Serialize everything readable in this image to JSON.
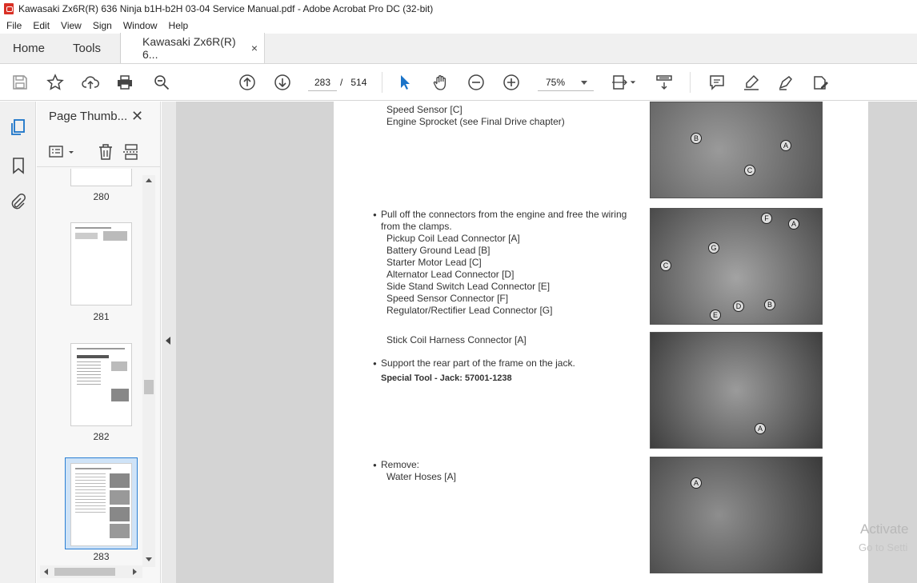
{
  "window": {
    "title": "Kawasaki Zx6R(R) 636 Ninja b1H-b2H 03-04 Service Manual.pdf - Adobe Acrobat Pro DC (32-bit)"
  },
  "menu": [
    "File",
    "Edit",
    "View",
    "Sign",
    "Window",
    "Help"
  ],
  "tabs": {
    "home": "Home",
    "tools": "Tools",
    "doc": "Kawasaki Zx6R(R) 6...",
    "close": "×"
  },
  "toolbar": {
    "current_page": "283",
    "separator": "/",
    "total_pages": "514",
    "zoom": "75%"
  },
  "panel": {
    "title": "Page Thumb...",
    "close": "✕",
    "thumbnails": [
      {
        "label": "280"
      },
      {
        "label": "281"
      },
      {
        "label": "282"
      },
      {
        "label": "283"
      }
    ]
  },
  "page": {
    "lines": {
      "l1": "Speed Sensor [C]",
      "l2": "Engine Sprocket (see Final Drive chapter)",
      "b1a": "Pull off the connectors from the engine and free the wiring",
      "b1b": "from the clamps.",
      "c1": "Pickup Coil Lead Connector [A]",
      "c2": "Battery Ground Lead [B]",
      "c3": "Starter Motor Lead [C]",
      "c4": "Alternator Lead Connector [D]",
      "c5": "Side Stand Switch Lead Connector [E]",
      "c6": "Speed Sensor Connector [F]",
      "c7": "Regulator/Rectifier Lead Connector [G]",
      "s1": "Stick Coil Harness Connector [A]",
      "b2": "Support the rear part of the frame on the jack.",
      "tool": "Special Tool -   Jack:  57001-1238",
      "b3": "Remove:",
      "r1": "Water Hoses [A]"
    },
    "photo_callouts": {
      "p1": [
        "B",
        "C",
        "A"
      ],
      "p2": [
        "F",
        "A",
        "G",
        "C",
        "D",
        "B",
        "E"
      ],
      "p3": [
        "A"
      ],
      "p4": [
        "A"
      ]
    }
  },
  "watermark": {
    "line1": "Activate",
    "line2": "Go to Setti"
  }
}
